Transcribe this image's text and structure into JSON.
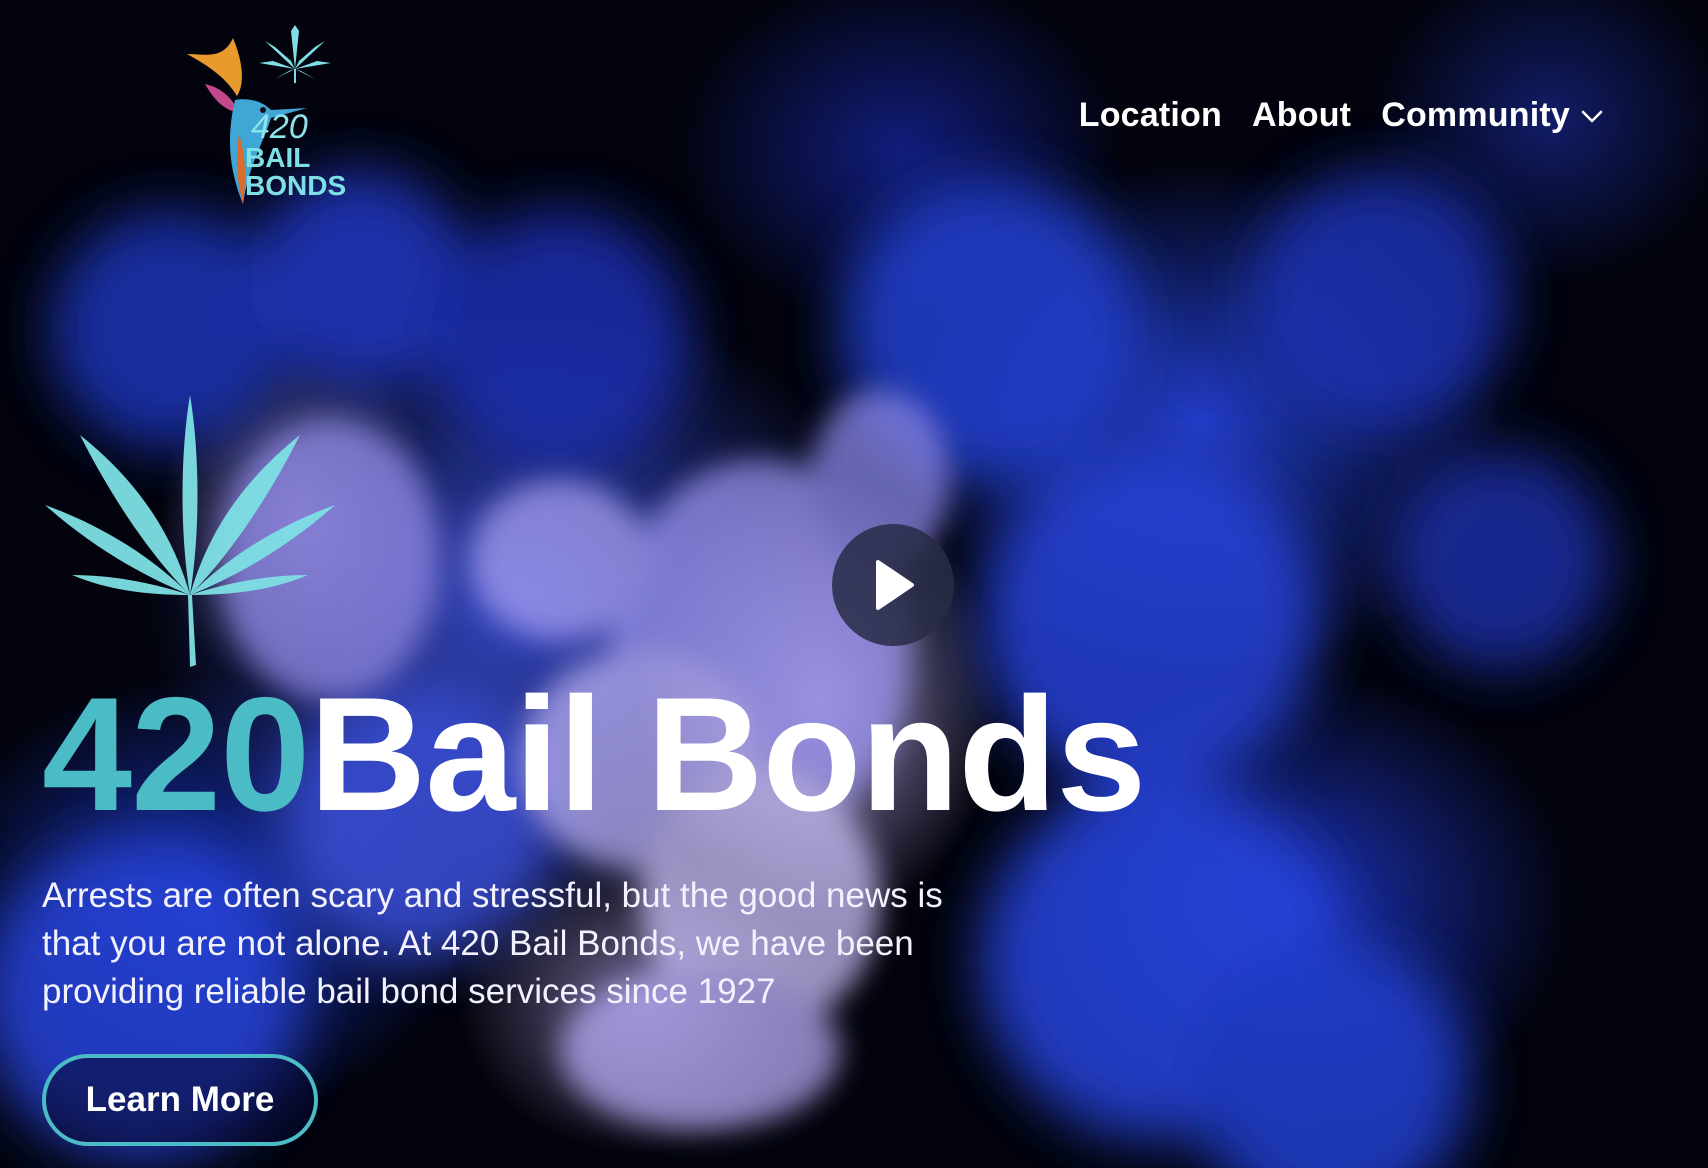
{
  "header": {
    "logo_line1": "420",
    "logo_line2": "BAIL",
    "logo_line3": "BONDS",
    "nav": [
      {
        "label": "Location"
      },
      {
        "label": "About"
      },
      {
        "label": "Community"
      }
    ]
  },
  "hero": {
    "title_accent": "420",
    "title_main": "Bail Bonds",
    "description": "Arrests are often scary and stressful, but the good news is that you are not alone. At 420 Bail Bonds, we have been providing reliable bail bond services since 1927",
    "cta_label": "Learn More"
  },
  "colors": {
    "accent": "#4bbcc6",
    "leaf": "#7ee0e4",
    "background": "#02030c",
    "smoke_blue": "#2a3fd6",
    "smoke_lavender": "#b9b0f5"
  },
  "icons": {
    "play": "play-icon",
    "chevron": "chevron-down-icon",
    "leaf": "cannabis-leaf-icon",
    "logo": "hummingbird-logo"
  }
}
